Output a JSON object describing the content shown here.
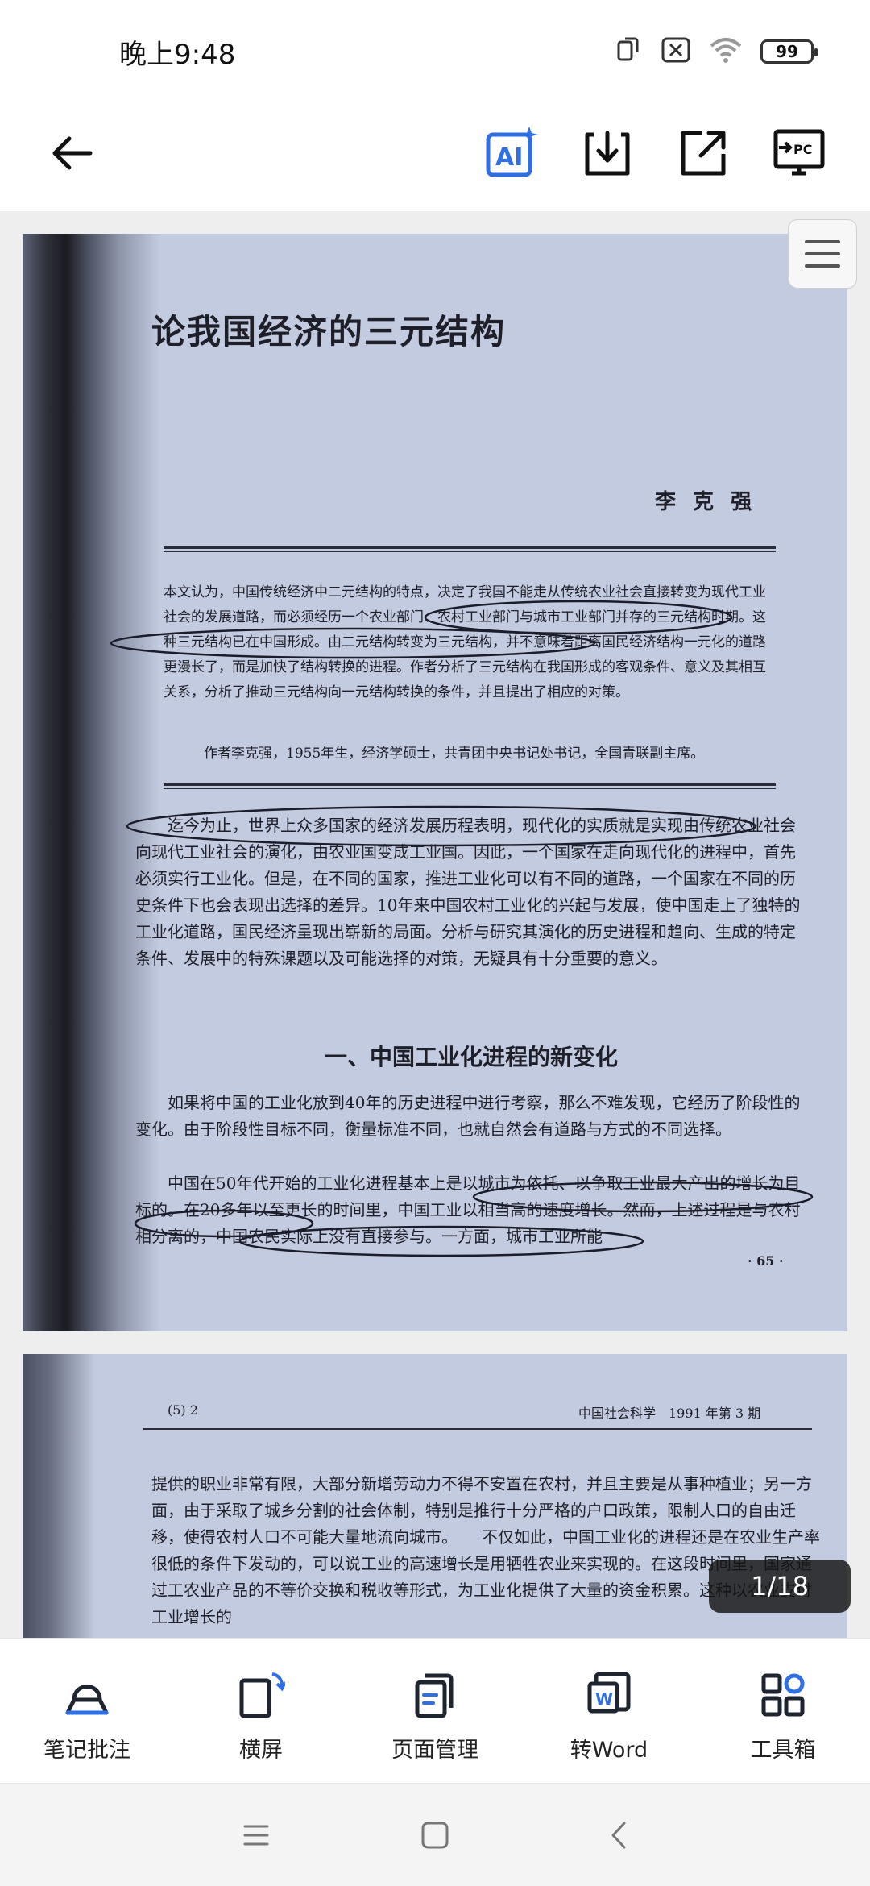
{
  "status": {
    "time": "晚上9:48",
    "battery": "99"
  },
  "toolbar": {
    "back": "back-arrow-icon",
    "actions": [
      "ai-icon",
      "download-icon",
      "share-icon",
      "pc-icon"
    ]
  },
  "document": {
    "page1": {
      "title": "论我国经济的三元结构",
      "author": "李 克 强",
      "abstract": "本文认为，中国传统经济中二元结构的特点，决定了我国不能走从传统农业社会直接转变为现代工业社会的发展道路，而必须经历一个农业部门、农村工业部门与城市工业部门并存的三元结构时期。这种三元结构已在中国形成。由二元结构转变为三元结构，并不意味着距离国民经济结构一元化的道路更漫长了，而是加快了结构转换的进程。作者分析了三元结构在我国形成的客观条件、意义及其相互关系，分析了推动三元结构向一元结构转换的条件，并且提出了相应的对策。",
      "bio": "作者李克强，1955年生，经济学硕士，共青团中央书记处书记，全国青联副主席。",
      "intro": "迄今为止，世界上众多国家的经济发展历程表明，现代化的实质就是实现由传统农业社会向现代工业社会的演化，由农业国变成工业国。因此，一个国家在走向现代化的进程中，首先必须实行工业化。但是，在不同的国家，推进工业化可以有不同的道路，一个国家在不同的历史条件下也会表现出选择的差异。10年来中国农村工业化的兴起与发展，使中国走上了独特的工业化道路，国民经济呈现出崭新的局面。分析与研究其演化的历史进程和趋向、生成的特定条件、发展中的特殊课题以及可能选择的对策，无疑具有十分重要的意义。",
      "section_title": "一、中国工业化进程的新变化",
      "para2": "如果将中国的工业化放到40年的历史进程中进行考察，那么不难发现，它经历了阶段性的变化。由于阶段性目标不同，衡量标准不同，也就自然会有道路与方式的不同选择。",
      "para3": "中国在50年代开始的工业化进程基本上是以城市为依托、以争取工业最大产出的增长为目标的。在20多年以至更长的时间里，中国工业以相当高的速度增长。然而，上述过程是与农村相分离的，中国农民实际上没有直接参与。一方面，城市工业所能",
      "page_number": "· 65 ·"
    },
    "page2": {
      "header": "(5) 2",
      "journal": "中国社会科学　1991 年第 3 期",
      "body": "提供的职业非常有限，大部分新增劳动力不得不安置在农村，并且主要是从事种植业；另一方面，由于采取了城乡分割的社会体制，特别是推行十分严格的户口政策，限制人口的自由迁移，使得农村人口不可能大量地流向城市。　　不仅如此，中国工业化的进程还是在农业生产率很低的条件下发动的，可以说工业的高速增长是用牺牲农业来实现的。在这段时间里，国家通过工农业产品的不等价交换和税收等形式，为工业化提供了大量的资金积累。这种以农业支付工业增长的"
    }
  },
  "page_indicator": "1/18",
  "bottom_bar": {
    "items": [
      {
        "label": "笔记批注",
        "icon": "annotate-icon"
      },
      {
        "label": "横屏",
        "icon": "rotate-icon"
      },
      {
        "label": "页面管理",
        "icon": "pages-icon"
      },
      {
        "label": "转Word",
        "icon": "word-icon"
      },
      {
        "label": "工具箱",
        "icon": "toolbox-icon"
      }
    ]
  },
  "colors": {
    "accent": "#2f6fe4",
    "page_tint": "#c3cbe0",
    "ink": "#1e1f29"
  }
}
